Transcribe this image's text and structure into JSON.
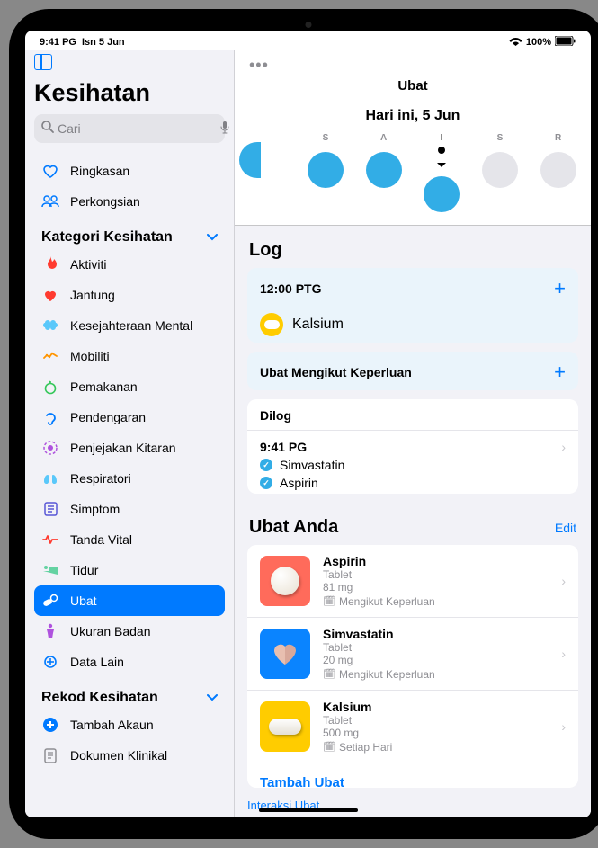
{
  "status_bar": {
    "time": "9:41 PG",
    "date": "Isn 5 Jun",
    "battery": "100%"
  },
  "sidebar": {
    "title": "Kesihatan",
    "search_placeholder": "Cari",
    "summary": "Ringkasan",
    "sharing": "Perkongsian",
    "cat_header": "Kategori Kesihatan",
    "rec_header": "Rekod Kesihatan",
    "categories": [
      {
        "label": "Aktiviti",
        "color": "#ff3b30",
        "icon": "flame"
      },
      {
        "label": "Jantung",
        "color": "#ff3b30",
        "icon": "heart"
      },
      {
        "label": "Kesejahteraan Mental",
        "color": "#5ac8fa",
        "icon": "brain"
      },
      {
        "label": "Mobiliti",
        "color": "#ff9500",
        "icon": "walk"
      },
      {
        "label": "Pemakanan",
        "color": "#34c759",
        "icon": "apple"
      },
      {
        "label": "Pendengaran",
        "color": "#007aff",
        "icon": "ear"
      },
      {
        "label": "Penjejakan Kitaran",
        "color": "#af52de",
        "icon": "cycle"
      },
      {
        "label": "Respiratori",
        "color": "#5ac8fa",
        "icon": "lungs"
      },
      {
        "label": "Simptom",
        "color": "#5856d6",
        "icon": "list"
      },
      {
        "label": "Tanda Vital",
        "color": "#ff3b30",
        "icon": "vital"
      },
      {
        "label": "Tidur",
        "color": "#64d2a2",
        "icon": "bed"
      },
      {
        "label": "Ubat",
        "color": "#007aff",
        "icon": "pills",
        "selected": true
      },
      {
        "label": "Ukuran Badan",
        "color": "#af52de",
        "icon": "body"
      },
      {
        "label": "Data Lain",
        "color": "#007aff",
        "icon": "other"
      }
    ],
    "records": [
      {
        "label": "Tambah Akaun",
        "color": "#007aff",
        "icon": "plus-circle"
      },
      {
        "label": "Dokumen Klinikal",
        "color": "#8e8e93",
        "icon": "doc"
      }
    ]
  },
  "main": {
    "title": "Ubat",
    "subtitle": "Hari ini, 5 Jun",
    "days": [
      {
        "label": "",
        "filled": true,
        "partial": true
      },
      {
        "label": "S",
        "filled": true
      },
      {
        "label": "A",
        "filled": true
      },
      {
        "label": "I",
        "filled": true,
        "today": true
      },
      {
        "label": "S",
        "filled": false
      },
      {
        "label": "R",
        "filled": false
      }
    ],
    "log_header": "Log",
    "log_time": "12:00 PTG",
    "log_med": "Kalsium",
    "as_needed": "Ubat Mengikut Keperluan",
    "logged_header": "Dilog",
    "logged_time": "9:41 PG",
    "logged_meds": [
      "Simvastatin",
      "Aspirin"
    ],
    "your_meds": "Ubat Anda",
    "edit": "Edit",
    "meds": [
      {
        "name": "Aspirin",
        "form": "Tablet",
        "dose": "81 mg",
        "schedule": "Mengikut Keperluan",
        "tile": "#ff6b5b",
        "shape": "round"
      },
      {
        "name": "Simvastatin",
        "form": "Tablet",
        "dose": "20 mg",
        "schedule": "Mengikut Keperluan",
        "tile": "#0a84ff",
        "shape": "heart"
      },
      {
        "name": "Kalsium",
        "form": "Tablet",
        "dose": "500 mg",
        "schedule": "Setiap Hari",
        "tile": "#ffcc00",
        "shape": "capsule"
      }
    ],
    "add_med": "Tambah Ubat",
    "extra": "Interaksi Ubat"
  }
}
